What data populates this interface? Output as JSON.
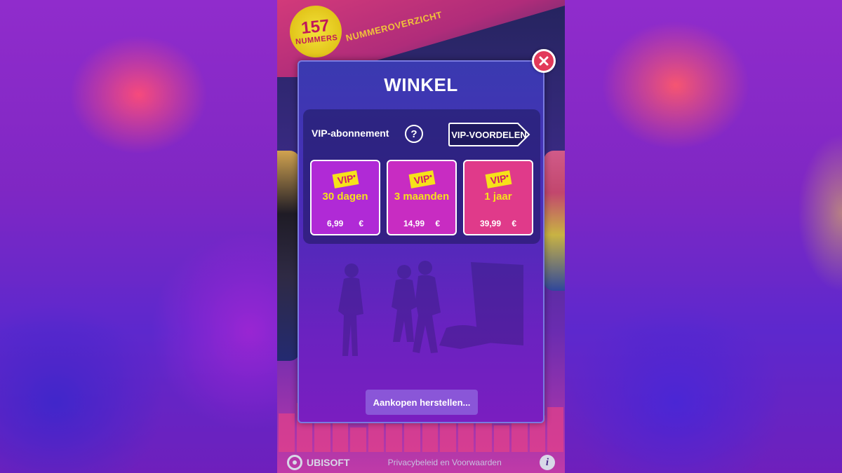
{
  "header": {
    "song_count": "157",
    "song_count_label": "NUMMERS",
    "overview_label": "NUMMEROVERZICHT"
  },
  "modal": {
    "title": "WINKEL",
    "close_icon": "close-icon",
    "subscription_label": "VIP-abonnement",
    "help_icon": "?",
    "benefits_button": "VIP-VOORDELEN",
    "plans": [
      {
        "tag": "VIP",
        "duration": "30 dagen",
        "price": "6,99",
        "currency": "€",
        "color": "#b02ad6"
      },
      {
        "tag": "VIP",
        "duration": "3 maanden",
        "price": "14,99",
        "currency": "€",
        "color": "#c82cc2"
      },
      {
        "tag": "VIP",
        "duration": "1 jaar",
        "price": "39,99",
        "currency": "€",
        "color": "#e03a8a"
      }
    ],
    "restore_button": "Aankopen herstellen..."
  },
  "footer": {
    "brand": "UBISOFT",
    "privacy_link": "Privacybeleid en Voorwaarden",
    "info_icon": "i"
  }
}
